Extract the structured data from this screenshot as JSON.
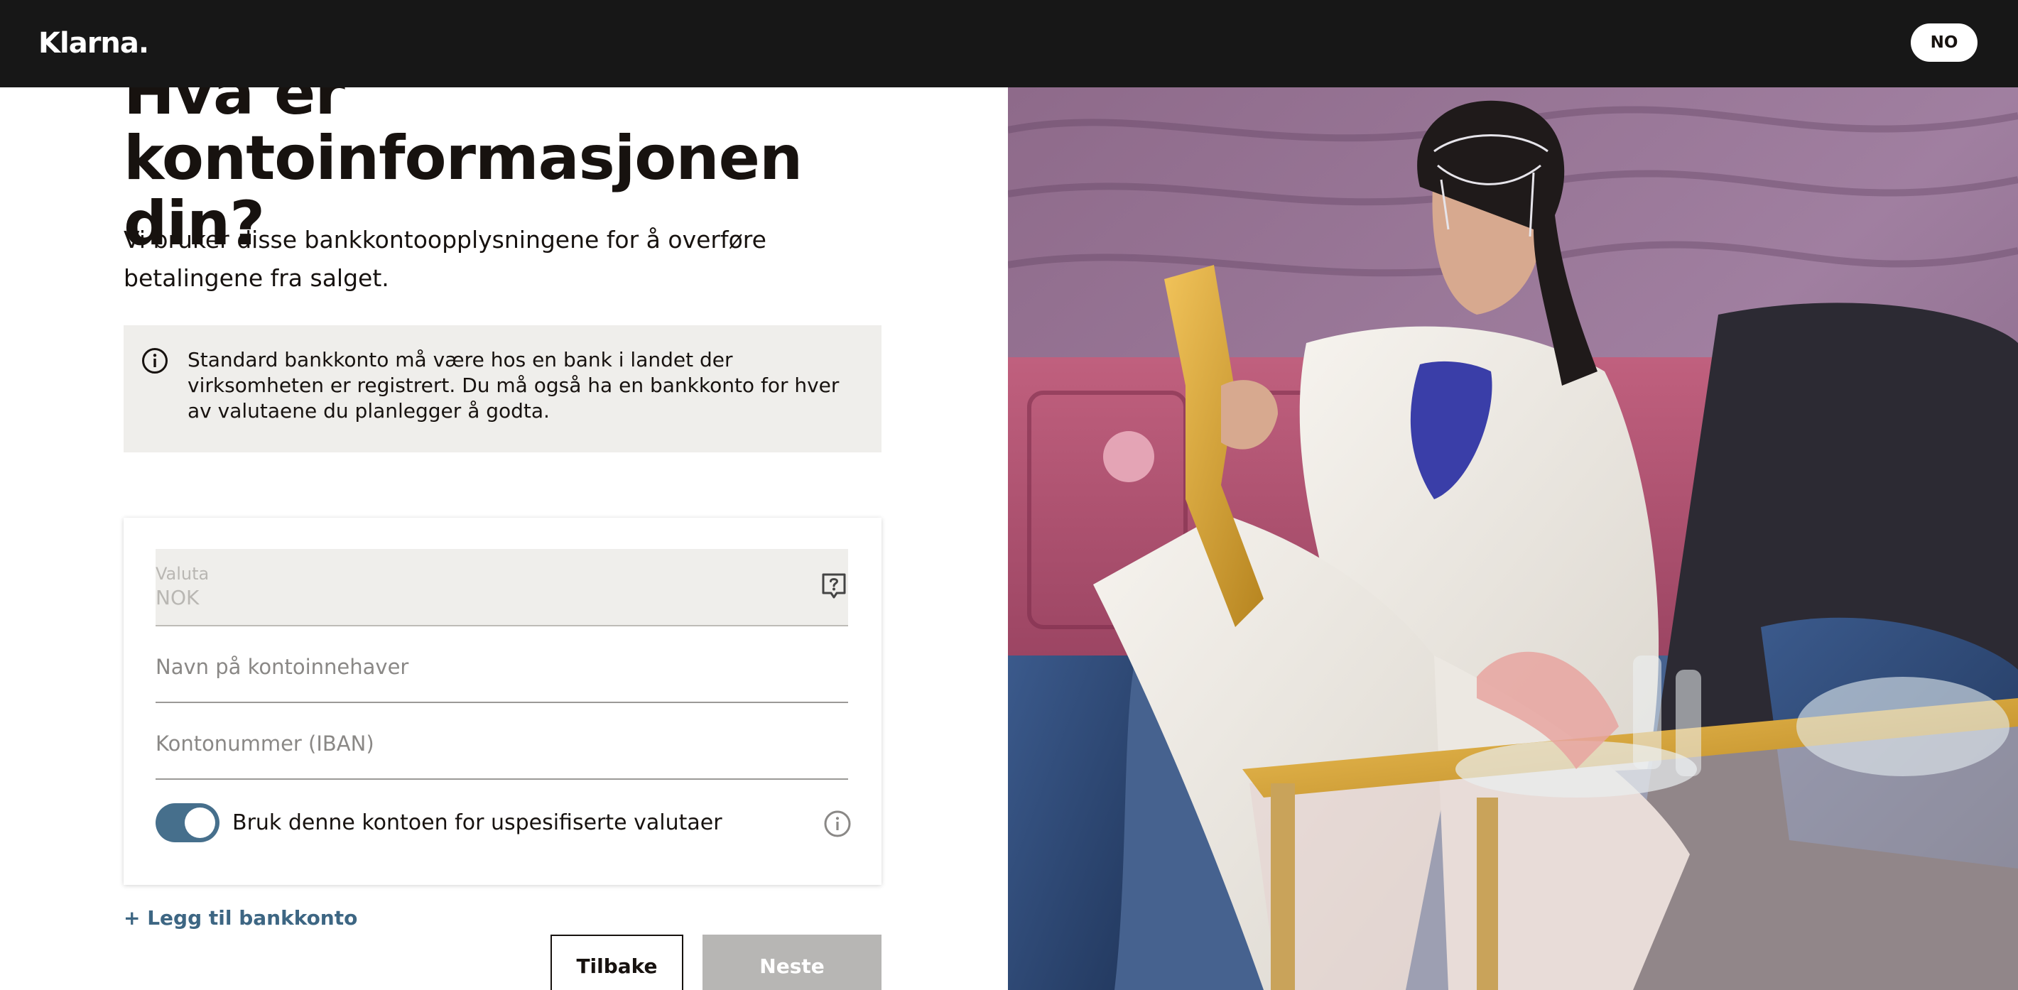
{
  "header": {
    "logo": "Klarna.",
    "language_button": "NO"
  },
  "main": {
    "heading": "Hva er kontoinformasjonen din?",
    "subtext": "Vi bruker disse bankkontoopplysningene for å overføre betalingene fra salget.",
    "info_text": "Standard bankkonto må være hos en bank i landet der virksomheten er registrert. Du må også ha en bankkonto for hver av valutaene du planlegger å godta."
  },
  "form": {
    "currency_label": "Valuta",
    "currency_value": "NOK",
    "account_holder_placeholder": "Navn på kontoinnehaver",
    "iban_placeholder": "Kontonummer (IBAN)",
    "toggle_label": "Bruk denne kontoen for uspesifiserte valutaer",
    "toggle_on": true
  },
  "actions": {
    "add_account": "+ Legg til bankkonto",
    "back": "Tilbake",
    "next": "Neste"
  },
  "icons": {
    "info": "info-icon",
    "help": "question-icon"
  },
  "colors": {
    "topbar": "#171717",
    "toggle": "#466f8c",
    "link": "#3d6683",
    "info_box": "#efeeeb",
    "next_disabled": "#b7b6b4"
  }
}
